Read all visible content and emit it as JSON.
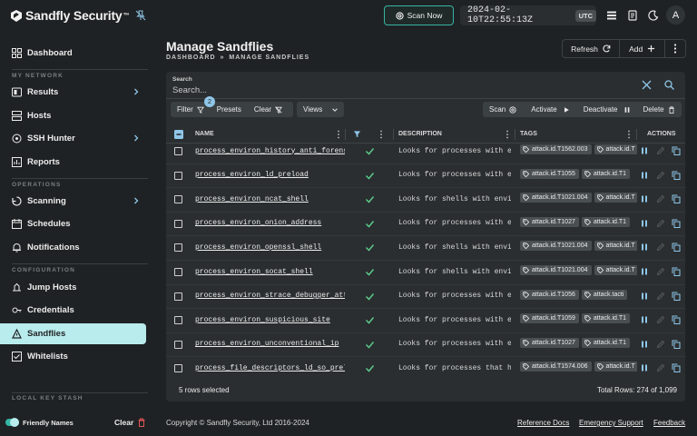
{
  "app": {
    "logo_text": "Sandfly Security",
    "logo_tm": "™",
    "scan_now_label": "Scan Now",
    "clock": "2024-02-10T22:55:13Z",
    "timezone": "UTC",
    "avatar_initial": "A",
    "accent_color": "#35b6a4"
  },
  "sidebar": {
    "dashboard": "Dashboard",
    "section_network": "MY NETWORK",
    "results": "Results",
    "hosts": "Hosts",
    "ssh_hunter": "SSH Hunter",
    "reports": "Reports",
    "section_operations": "OPERATIONS",
    "scanning": "Scanning",
    "schedules": "Schedules",
    "notifications": "Notifications",
    "section_configuration": "CONFIGURATION",
    "jump_hosts": "Jump Hosts",
    "credentials": "Credentials",
    "sandflies": "Sandflies",
    "whitelists": "Whitelists",
    "section_local_key_stash": "LOCAL KEY STASH",
    "friendly_names": "Friendly Names",
    "clear": "Clear"
  },
  "page": {
    "title": "Manage Sandflies",
    "breadcrumb_root": "DASHBOARD",
    "breadcrumb_sep": "»",
    "breadcrumb_current": "MANAGE SANDFLIES",
    "refresh": "Refresh",
    "add": "Add"
  },
  "search": {
    "label": "Search",
    "placeholder": "Search..."
  },
  "toolbar": {
    "filter": "Filter",
    "filter_count": "2",
    "presets": "Presets",
    "clear": "Clear",
    "views": "Views",
    "scan": "Scan",
    "activate": "Activate",
    "deactivate": "Deactivate",
    "delete": "Delete"
  },
  "table": {
    "col_name": "NAME",
    "col_description": "DESCRIPTION",
    "col_tags": "TAGS",
    "col_actions": "ACTIONS",
    "rows": [
      {
        "name": "process_environ_history_anti_forens",
        "description": "Looks for processes with env",
        "tags": [
          "attack.id.T1562.003",
          "attack.id.T"
        ]
      },
      {
        "name": "process_environ_ld_preload",
        "description": "Looks for processes with env",
        "tags": [
          "attack.id.T1055",
          "attack.id.T1"
        ]
      },
      {
        "name": "process_environ_ncat_shell",
        "description": "Looks for shells with enviro",
        "tags": [
          "attack.id.T1021.004",
          "attack.id.T"
        ]
      },
      {
        "name": "process_environ_onion_address",
        "description": "Looks for processes with env",
        "tags": [
          "attack.id.T1027",
          "attack.id.T1"
        ]
      },
      {
        "name": "process_environ_openssl_shell",
        "description": "Looks for shells with enviro",
        "tags": [
          "attack.id.T1021.004",
          "attack.id.T"
        ]
      },
      {
        "name": "process_environ_socat_shell",
        "description": "Looks for shells with enviro",
        "tags": [
          "attack.id.T1021.004",
          "attack.id.T"
        ]
      },
      {
        "name": "process_environ_strace_debugger_att",
        "description": "Looks for processes with env",
        "tags": [
          "attack.id.T1056",
          "attack.tacti"
        ]
      },
      {
        "name": "process_environ_suspicious_site",
        "description": "Looks for processes with env",
        "tags": [
          "attack.id.T1059",
          "attack.id.T1"
        ]
      },
      {
        "name": "process_environ_unconventional_ip",
        "description": "Looks for processes with env",
        "tags": [
          "attack.id.T1027",
          "attack.id.T1"
        ]
      },
      {
        "name": "process_file_descriptors_ld_so_prel",
        "description": "Looks for processes that hav",
        "tags": [
          "attack.id.T1574.006",
          "attack.id.T"
        ]
      }
    ]
  },
  "panel_footer": {
    "rows_selected": "5 rows selected",
    "total_rows": "Total Rows: 274 of 1,099"
  },
  "footer": {
    "copyright": "Copyright © Sandfly Security, Ltd 2016-2024",
    "reference_docs": "Reference Docs",
    "emergency_support": "Emergency Support",
    "feedback": "Feedback"
  }
}
